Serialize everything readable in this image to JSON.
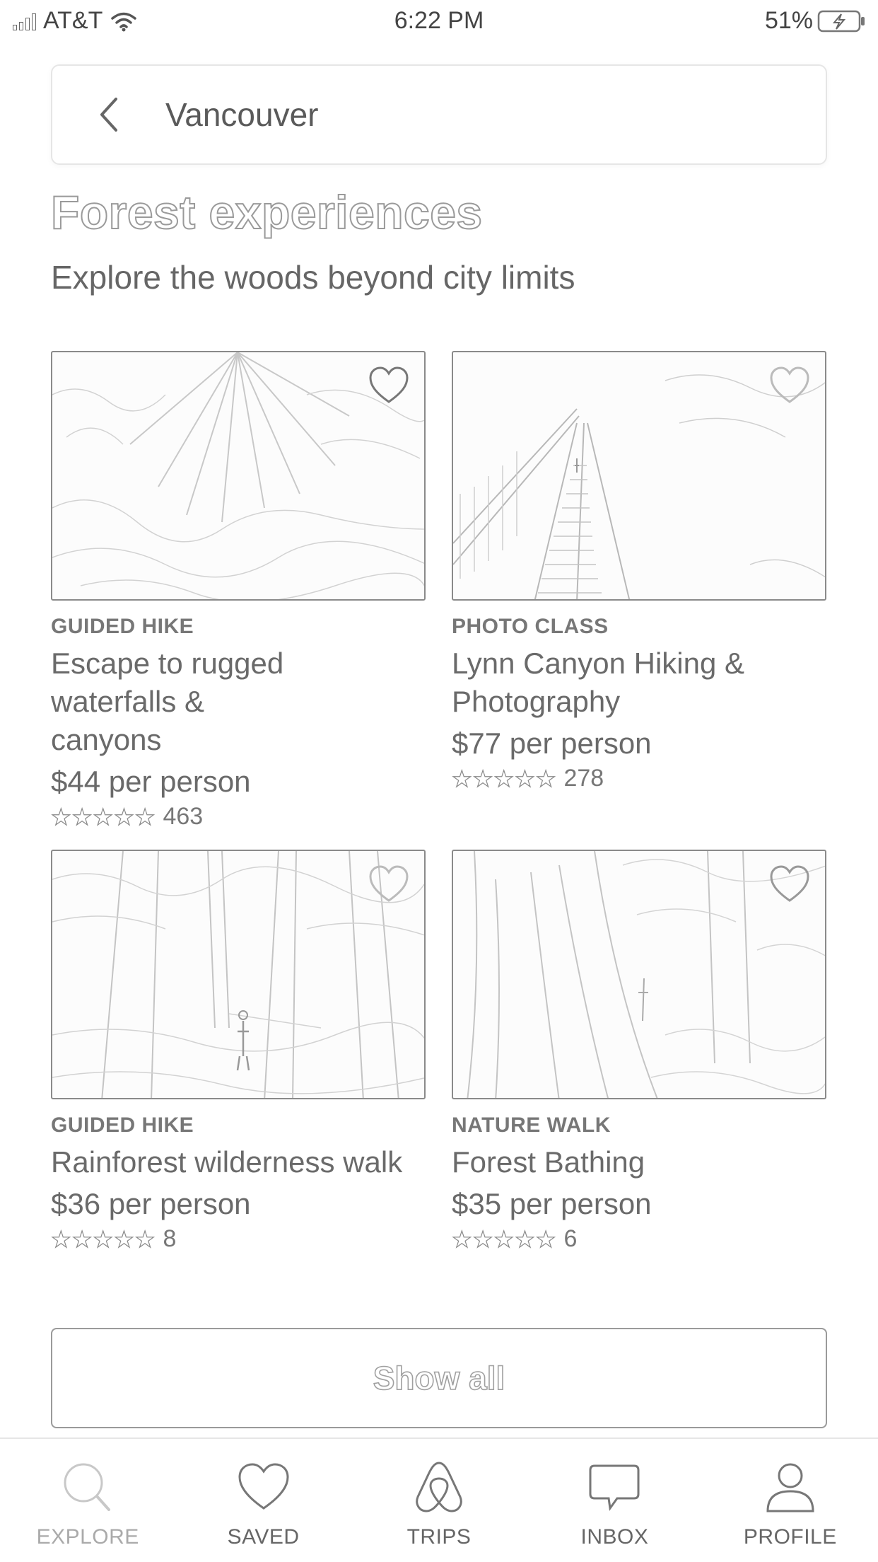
{
  "status_bar": {
    "carrier": "AT&T",
    "time": "6:22 PM",
    "battery": "51%"
  },
  "search": {
    "location": "Vancouver"
  },
  "section": {
    "title": "Forest experiences",
    "subtitle": "Explore the woods beyond city limits"
  },
  "cards": [
    {
      "category": "GUIDED HIKE",
      "title": "Escape to rugged waterfalls & canyons",
      "price": "$44 per person",
      "stars": "★★★★★",
      "reviews": "463"
    },
    {
      "category": "PHOTO CLASS",
      "title": "Lynn Canyon Hiking & Photography",
      "price": "$77 per person",
      "stars": "★★★★★",
      "reviews": "278"
    },
    {
      "category": "GUIDED HIKE",
      "title": "Rainforest wilderness walk",
      "price": "$36 per person",
      "stars": "★★★★★",
      "reviews": "8"
    },
    {
      "category": "NATURE WALK",
      "title": "Forest Bathing",
      "price": "$35 per person",
      "stars": "★★★★★",
      "reviews": "6"
    }
  ],
  "show_all_label": "Show all",
  "tabs": [
    {
      "label": "EXPLORE",
      "icon": "search-icon",
      "active": true
    },
    {
      "label": "SAVED",
      "icon": "heart-icon",
      "active": false
    },
    {
      "label": "TRIPS",
      "icon": "airbnb-logo-icon",
      "active": false
    },
    {
      "label": "INBOX",
      "icon": "chat-bubble-icon",
      "active": false
    },
    {
      "label": "PROFILE",
      "icon": "person-icon",
      "active": false
    }
  ]
}
